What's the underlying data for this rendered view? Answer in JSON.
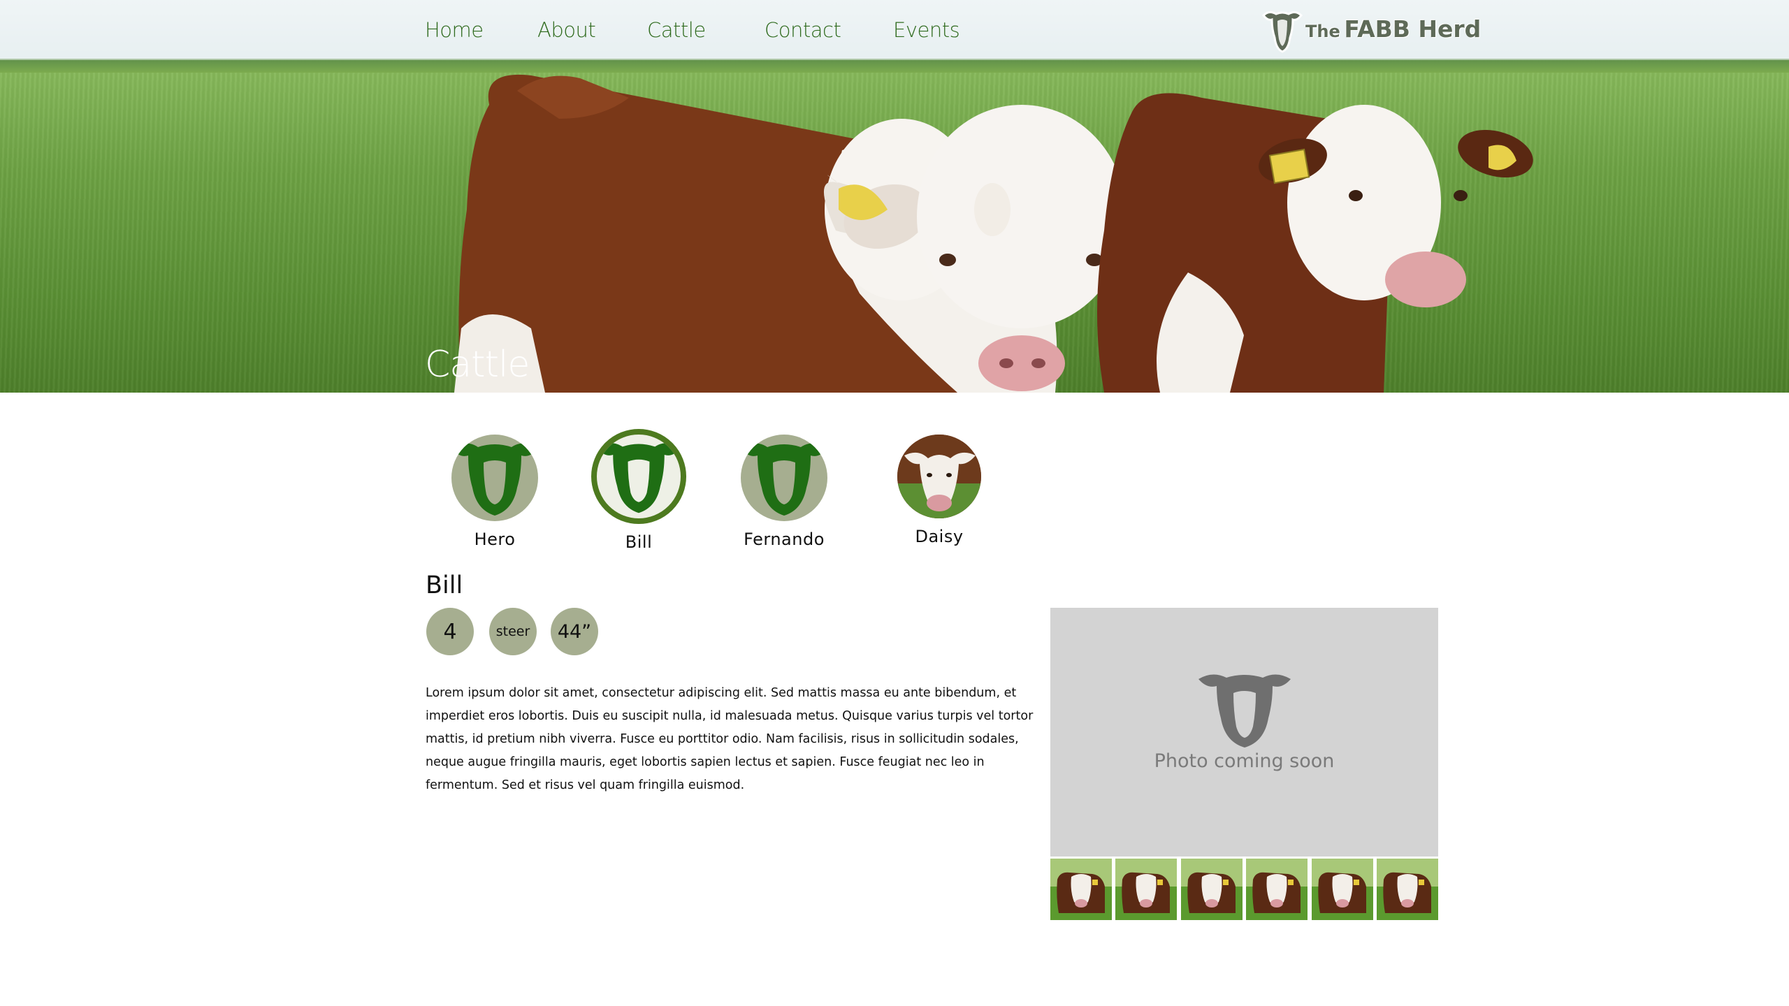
{
  "nav": {
    "links": [
      "Home",
      "About",
      "Cattle",
      "Contact",
      "Events"
    ]
  },
  "logo": {
    "prefix": "The",
    "name": "FABB Herd"
  },
  "hero": {
    "title": "Cattle"
  },
  "cattle": {
    "items": [
      {
        "name": "Hero",
        "icon": "cow-head-icon",
        "selected": false
      },
      {
        "name": "Bill",
        "icon": "cow-head-icon",
        "selected": true
      },
      {
        "name": "Fernando",
        "icon": "cow-head-icon",
        "selected": false
      },
      {
        "name": "Daisy",
        "icon": "cow-photo",
        "selected": false
      }
    ]
  },
  "detail": {
    "name": "Bill",
    "age": "4",
    "type": "steer",
    "height": "44”",
    "description": "Lorem ipsum dolor sit amet, consectetur adipiscing elit. Sed mattis massa eu ante bibendum, et imperdiet eros lobortis. Duis eu suscipit nulla, id malesuada metus. Quisque varius turpis vel tortor mattis, id pretium nibh viverra. Fusce eu porttitor odio. Nam facilisis, risus in sollicitudin sodales, neque augue fringilla mauris, eget lobortis sapien lectus et sapien. Fusce feugiat nec leo in fermentum. Sed et risus vel quam fringilla euismod.",
    "photo_placeholder": "Photo coming soon",
    "thumbnail_count": 6
  },
  "colors": {
    "nav_text": "#2f6b1e",
    "icon_green": "#1f6e14",
    "badge_bg": "#a6ae90",
    "selected_ring": "#4d7a1f",
    "photo_bg": "#d3d3d3"
  }
}
